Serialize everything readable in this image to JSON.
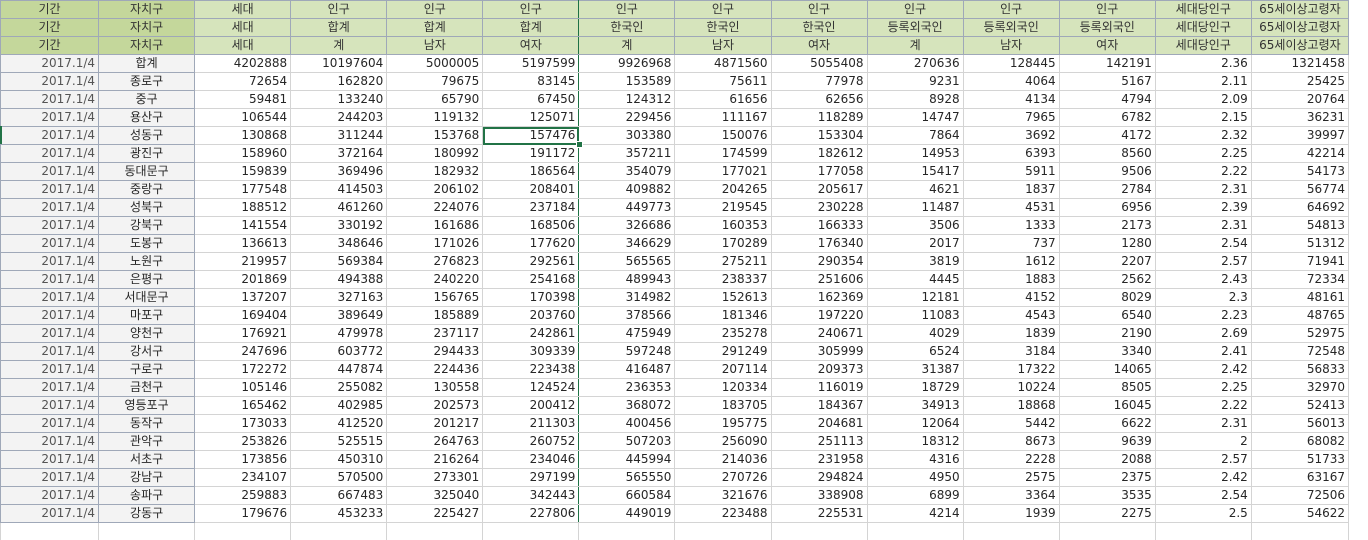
{
  "header_rows": [
    [
      "기간",
      "자치구",
      "세대",
      "인구",
      "인구",
      "인구",
      "인구",
      "인구",
      "인구",
      "인구",
      "인구",
      "인구",
      "세대당인구",
      "65세이상고령자"
    ],
    [
      "기간",
      "자치구",
      "세대",
      "합계",
      "합계",
      "합계",
      "한국인",
      "한국인",
      "한국인",
      "등록외국인",
      "등록외국인",
      "등록외국인",
      "세대당인구",
      "65세이상고령자"
    ],
    [
      "기간",
      "자치구",
      "세대",
      "계",
      "남자",
      "여자",
      "계",
      "남자",
      "여자",
      "계",
      "남자",
      "여자",
      "세대당인구",
      "65세이상고령자"
    ]
  ],
  "rows": [
    [
      "2017.1/4",
      "합계",
      "4202888",
      "10197604",
      "5000005",
      "5197599",
      "9926968",
      "4871560",
      "5055408",
      "270636",
      "128445",
      "142191",
      "2.36",
      "1321458"
    ],
    [
      "2017.1/4",
      "종로구",
      "72654",
      "162820",
      "79675",
      "83145",
      "153589",
      "75611",
      "77978",
      "9231",
      "4064",
      "5167",
      "2.11",
      "25425"
    ],
    [
      "2017.1/4",
      "중구",
      "59481",
      "133240",
      "65790",
      "67450",
      "124312",
      "61656",
      "62656",
      "8928",
      "4134",
      "4794",
      "2.09",
      "20764"
    ],
    [
      "2017.1/4",
      "용산구",
      "106544",
      "244203",
      "119132",
      "125071",
      "229456",
      "111167",
      "118289",
      "14747",
      "7965",
      "6782",
      "2.15",
      "36231"
    ],
    [
      "2017.1/4",
      "성동구",
      "130868",
      "311244",
      "153768",
      "157476",
      "303380",
      "150076",
      "153304",
      "7864",
      "3692",
      "4172",
      "2.32",
      "39997"
    ],
    [
      "2017.1/4",
      "광진구",
      "158960",
      "372164",
      "180992",
      "191172",
      "357211",
      "174599",
      "182612",
      "14953",
      "6393",
      "8560",
      "2.25",
      "42214"
    ],
    [
      "2017.1/4",
      "동대문구",
      "159839",
      "369496",
      "182932",
      "186564",
      "354079",
      "177021",
      "177058",
      "15417",
      "5911",
      "9506",
      "2.22",
      "54173"
    ],
    [
      "2017.1/4",
      "중랑구",
      "177548",
      "414503",
      "206102",
      "208401",
      "409882",
      "204265",
      "205617",
      "4621",
      "1837",
      "2784",
      "2.31",
      "56774"
    ],
    [
      "2017.1/4",
      "성북구",
      "188512",
      "461260",
      "224076",
      "237184",
      "449773",
      "219545",
      "230228",
      "11487",
      "4531",
      "6956",
      "2.39",
      "64692"
    ],
    [
      "2017.1/4",
      "강북구",
      "141554",
      "330192",
      "161686",
      "168506",
      "326686",
      "160353",
      "166333",
      "3506",
      "1333",
      "2173",
      "2.31",
      "54813"
    ],
    [
      "2017.1/4",
      "도봉구",
      "136613",
      "348646",
      "171026",
      "177620",
      "346629",
      "170289",
      "176340",
      "2017",
      "737",
      "1280",
      "2.54",
      "51312"
    ],
    [
      "2017.1/4",
      "노원구",
      "219957",
      "569384",
      "276823",
      "292561",
      "565565",
      "275211",
      "290354",
      "3819",
      "1612",
      "2207",
      "2.57",
      "71941"
    ],
    [
      "2017.1/4",
      "은평구",
      "201869",
      "494388",
      "240220",
      "254168",
      "489943",
      "238337",
      "251606",
      "4445",
      "1883",
      "2562",
      "2.43",
      "72334"
    ],
    [
      "2017.1/4",
      "서대문구",
      "137207",
      "327163",
      "156765",
      "170398",
      "314982",
      "152613",
      "162369",
      "12181",
      "4152",
      "8029",
      "2.3",
      "48161"
    ],
    [
      "2017.1/4",
      "마포구",
      "169404",
      "389649",
      "185889",
      "203760",
      "378566",
      "181346",
      "197220",
      "11083",
      "4543",
      "6540",
      "2.23",
      "48765"
    ],
    [
      "2017.1/4",
      "양천구",
      "176921",
      "479978",
      "237117",
      "242861",
      "475949",
      "235278",
      "240671",
      "4029",
      "1839",
      "2190",
      "2.69",
      "52975"
    ],
    [
      "2017.1/4",
      "강서구",
      "247696",
      "603772",
      "294433",
      "309339",
      "597248",
      "291249",
      "305999",
      "6524",
      "3184",
      "3340",
      "2.41",
      "72548"
    ],
    [
      "2017.1/4",
      "구로구",
      "172272",
      "447874",
      "224436",
      "223438",
      "416487",
      "207114",
      "209373",
      "31387",
      "17322",
      "14065",
      "2.42",
      "56833"
    ],
    [
      "2017.1/4",
      "금천구",
      "105146",
      "255082",
      "130558",
      "124524",
      "236353",
      "120334",
      "116019",
      "18729",
      "10224",
      "8505",
      "2.25",
      "32970"
    ],
    [
      "2017.1/4",
      "영등포구",
      "165462",
      "402985",
      "202573",
      "200412",
      "368072",
      "183705",
      "184367",
      "34913",
      "18868",
      "16045",
      "2.22",
      "52413"
    ],
    [
      "2017.1/4",
      "동작구",
      "173033",
      "412520",
      "201217",
      "211303",
      "400456",
      "195775",
      "204681",
      "12064",
      "5442",
      "6622",
      "2.31",
      "56013"
    ],
    [
      "2017.1/4",
      "관악구",
      "253826",
      "525515",
      "264763",
      "260752",
      "507203",
      "256090",
      "251113",
      "18312",
      "8673",
      "9639",
      "2",
      "68082"
    ],
    [
      "2017.1/4",
      "서초구",
      "173856",
      "450310",
      "216264",
      "234046",
      "445994",
      "214036",
      "231958",
      "4316",
      "2228",
      "2088",
      "2.57",
      "51733"
    ],
    [
      "2017.1/4",
      "강남구",
      "234107",
      "570500",
      "273301",
      "297199",
      "565550",
      "270726",
      "294824",
      "4950",
      "2575",
      "2375",
      "2.42",
      "63167"
    ],
    [
      "2017.1/4",
      "송파구",
      "259883",
      "667483",
      "325040",
      "342443",
      "660584",
      "321676",
      "338908",
      "6899",
      "3364",
      "3535",
      "2.54",
      "72506"
    ],
    [
      "2017.1/4",
      "강동구",
      "179676",
      "453233",
      "225427",
      "227806",
      "449019",
      "223488",
      "225531",
      "4214",
      "1939",
      "2275",
      "2.5",
      "54622"
    ]
  ]
}
